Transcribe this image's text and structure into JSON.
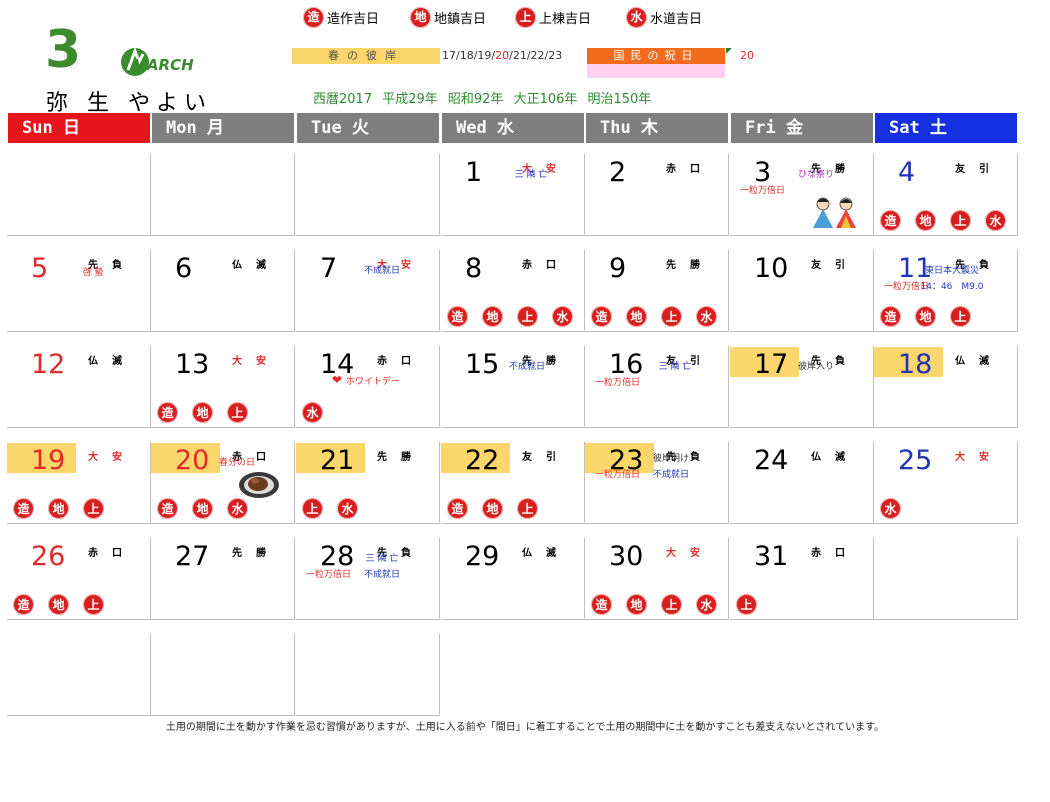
{
  "legend": [
    {
      "badge": "造",
      "label": "造作吉日"
    },
    {
      "badge": "地",
      "label": "地鎮吉日"
    },
    {
      "badge": "上",
      "label": "上棟吉日"
    },
    {
      "badge": "水",
      "label": "水道吉日"
    }
  ],
  "month_number": "3",
  "month_name": "MARCH",
  "kyureki": "弥 生 やよい",
  "higan": {
    "label": "春の彼岸",
    "days_prefix": "17/18/19/",
    "days_red": "20",
    "days_suffix": "/21/22/23"
  },
  "holiday": {
    "label": "国民の祝日",
    "day": "20"
  },
  "eras": "西暦2017 平成29年 昭和92年 大正106年 明治150年",
  "weekdays": [
    {
      "label": "Sun 日",
      "color": "#e8141b"
    },
    {
      "label": "Mon 月",
      "color": "#7f7f7f"
    },
    {
      "label": "Tue 火",
      "color": "#7f7f7f"
    },
    {
      "label": "Wed 水",
      "color": "#7f7f7f"
    },
    {
      "label": "Thu 木",
      "color": "#7f7f7f"
    },
    {
      "label": "Fri 金",
      "color": "#7f7f7f"
    },
    {
      "label": "Sat 土",
      "color": "#1430e0"
    }
  ],
  "days": [
    {
      "day": "1",
      "rokuyo": "大安",
      "rokuyo_red": true,
      "notes": [
        {
          "text": "三 隣 亡",
          "color": "blue"
        }
      ],
      "badges": []
    },
    {
      "day": "2",
      "rokuyo": "赤口",
      "notes": [],
      "badges": []
    },
    {
      "day": "3",
      "rokuyo": "先勝",
      "notes": [
        {
          "text": "ひな祭り",
          "color": "purple"
        },
        {
          "text": "一粒万倍日",
          "color": "red"
        }
      ],
      "badges": [],
      "hina": true
    },
    {
      "day": "4",
      "rokuyo": "友引",
      "notes": [],
      "badges": [
        "造",
        "地",
        "上",
        "水"
      ]
    },
    {
      "day": "5",
      "rokuyo": "先負",
      "notes": [
        {
          "text": "啓 蟄",
          "color": "red"
        }
      ],
      "badges": []
    },
    {
      "day": "6",
      "rokuyo": "仏滅",
      "notes": [],
      "badges": []
    },
    {
      "day": "7",
      "rokuyo": "大安",
      "rokuyo_red": true,
      "notes": [
        {
          "text": "不成就日",
          "color": "blue"
        }
      ],
      "badges": []
    },
    {
      "day": "8",
      "rokuyo": "赤口",
      "notes": [],
      "badges": [
        "造",
        "地",
        "上",
        "水"
      ]
    },
    {
      "day": "9",
      "rokuyo": "先勝",
      "notes": [],
      "badges": [
        "造",
        "地",
        "上",
        "水"
      ]
    },
    {
      "day": "10",
      "rokuyo": "友引",
      "notes": [],
      "badges": []
    },
    {
      "day": "11",
      "rokuyo": "先負",
      "notes": [
        {
          "text": "東日本大震災",
          "color": "blue"
        },
        {
          "text": "一粒万倍日",
          "color": "red"
        },
        {
          "text": "14：46　M9.0",
          "color": "blue"
        }
      ],
      "badges": [
        "造",
        "地",
        "上"
      ]
    },
    {
      "day": "12",
      "rokuyo": "仏滅",
      "notes": [],
      "badges": []
    },
    {
      "day": "13",
      "rokuyo": "大安",
      "rokuyo_red": true,
      "notes": [],
      "badges": [
        "造",
        "地",
        "上"
      ]
    },
    {
      "day": "14",
      "rokuyo": "赤口",
      "notes": [
        {
          "text": "ホワイトデー",
          "color": "red"
        }
      ],
      "badges": [
        "水"
      ],
      "heart": true
    },
    {
      "day": "15",
      "rokuyo": "先勝",
      "notes": [
        {
          "text": "不成就日",
          "color": "blue"
        }
      ],
      "badges": []
    },
    {
      "day": "16",
      "rokuyo": "友引",
      "notes": [
        {
          "text": "一粒万倍日",
          "color": "red"
        },
        {
          "text": "三 隣 亡",
          "color": "blue"
        }
      ],
      "badges": []
    },
    {
      "day": "17",
      "rokuyo": "先負",
      "notes": [
        {
          "text": "彼岸入り",
          "color": "dark"
        }
      ],
      "badges": [],
      "hl": true
    },
    {
      "day": "18",
      "rokuyo": "仏滅",
      "notes": [],
      "badges": [],
      "hl": true
    },
    {
      "day": "19",
      "rokuyo": "大安",
      "rokuyo_red": true,
      "notes": [],
      "badges": [
        "造",
        "地",
        "上"
      ],
      "hl": true
    },
    {
      "day": "20",
      "rokuyo": "赤口",
      "notes": [
        {
          "text": "春分の日",
          "color": "red"
        }
      ],
      "badges": [
        "造",
        "地",
        "水"
      ],
      "hl": true,
      "ohagi": true
    },
    {
      "day": "21",
      "rokuyo": "先勝",
      "notes": [],
      "badges": [
        "上",
        "水"
      ],
      "hl": true
    },
    {
      "day": "22",
      "rokuyo": "友引",
      "notes": [],
      "badges": [
        "造",
        "地",
        "上"
      ],
      "hl": true
    },
    {
      "day": "23",
      "rokuyo": "先負",
      "notes": [
        {
          "text": "彼岸明け",
          "color": "dark"
        },
        {
          "text": "一粒万倍日",
          "color": "red"
        },
        {
          "text": "不成就日",
          "color": "blue"
        }
      ],
      "badges": [],
      "hl": true
    },
    {
      "day": "24",
      "rokuyo": "仏滅",
      "notes": [],
      "badges": []
    },
    {
      "day": "25",
      "rokuyo": "大安",
      "rokuyo_red": true,
      "notes": [],
      "badges": [
        "水"
      ]
    },
    {
      "day": "26",
      "rokuyo": "赤口",
      "notes": [],
      "badges": [
        "造",
        "地",
        "上"
      ]
    },
    {
      "day": "27",
      "rokuyo": "先勝",
      "notes": [],
      "badges": []
    },
    {
      "day": "28",
      "rokuyo": "先負",
      "notes": [
        {
          "text": "三 隣 亡",
          "color": "blue"
        },
        {
          "text": "一粒万倍日",
          "color": "red"
        },
        {
          "text": "不成就日",
          "color": "blue"
        }
      ],
      "badges": []
    },
    {
      "day": "29",
      "rokuyo": "仏滅",
      "notes": [],
      "badges": []
    },
    {
      "day": "30",
      "rokuyo": "大安",
      "rokuyo_red": true,
      "notes": [],
      "badges": [
        "造",
        "地",
        "上",
        "水"
      ]
    },
    {
      "day": "31",
      "rokuyo": "赤口",
      "notes": [],
      "badges": [
        "上"
      ]
    }
  ],
  "footer": "土用の期間に土を動かす作業を忌む習慣がありますが、土用に入る前や「間日」に着工することで土用の期間中に土を動かすことも差支えないとされています。"
}
